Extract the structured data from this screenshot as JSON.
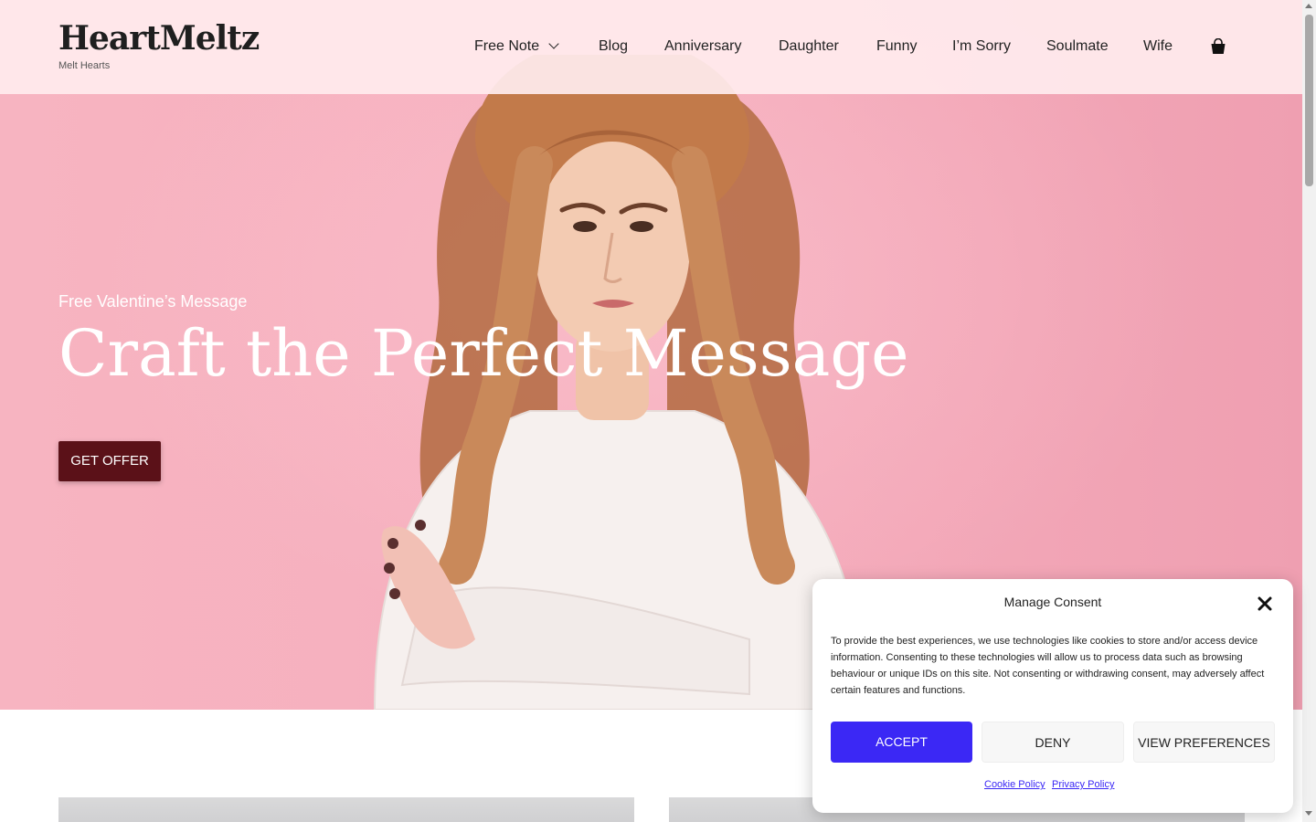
{
  "header": {
    "brand_title": "HeartMeltz",
    "brand_tagline": "Melt Hearts",
    "nav": [
      {
        "label": "Free Note"
      },
      {
        "label": "Blog"
      },
      {
        "label": "Anniversary"
      },
      {
        "label": "Daughter"
      },
      {
        "label": "Funny"
      },
      {
        "label": "I’m Sorry"
      },
      {
        "label": "Soulmate"
      },
      {
        "label": "Wife"
      }
    ],
    "cart_icon": "shopping-bag-icon"
  },
  "hero": {
    "subtitle": "Free Valentine’s Message",
    "title": "Craft the Perfect Message",
    "cta_label": "GET OFFER"
  },
  "consent": {
    "title": "Manage Consent",
    "body": "To provide the best experiences, we use technologies like cookies to store and/or access device information. Consenting to these technologies will allow us to process data such as browsing behaviour or unique IDs on this site. Not consenting or withdrawing consent, may adversely affect certain features and functions.",
    "accept_label": "ACCEPT",
    "deny_label": "DENY",
    "preferences_label": "VIEW PREFERENCES",
    "cookie_policy_label": "Cookie Policy",
    "privacy_policy_label": "Privacy Policy"
  },
  "colors": {
    "accept_button": "#3b28f5",
    "cta_button": "#5b1118",
    "hero_background": "#f7b4c1"
  }
}
